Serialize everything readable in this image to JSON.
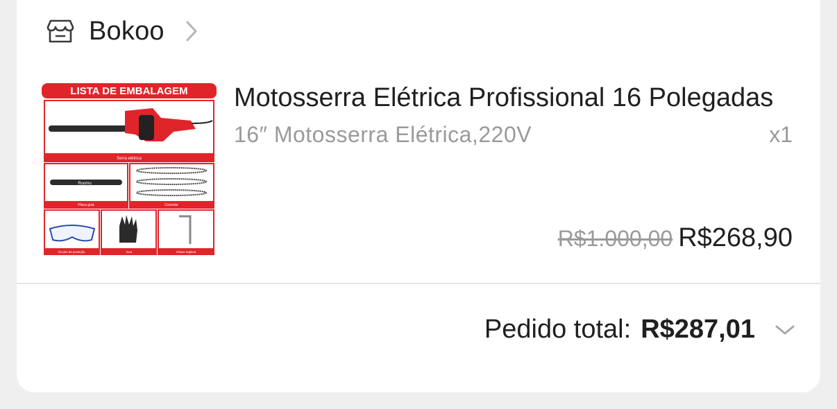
{
  "store": {
    "name": "Bokoo",
    "icon": "store-icon",
    "chevron_icon": "chevron-right-icon"
  },
  "product": {
    "image_header": "LISTA DE EMBALAGEM",
    "image_labels": {
      "saw": "Serra elétrica",
      "bar": "Placa guia",
      "chain": "Corrente",
      "glasses": "Óculos de proteção",
      "gloves": "luva",
      "wrench": "Chave inglesa"
    },
    "title": "Motosserra Elétrica Profissional 16 Polegadas",
    "variant": "16″ Motosserra Elétrica,220V",
    "quantity": "x1",
    "original_price": "R$1.000,00",
    "price": "R$268,90"
  },
  "order": {
    "total_label": "Pedido total:",
    "total_value": "R$287,01",
    "expand_icon": "chevron-down-icon"
  },
  "colors": {
    "text_primary": "#1f1f1f",
    "text_secondary": "#9a9a9a",
    "image_accent": "#e0252a"
  }
}
